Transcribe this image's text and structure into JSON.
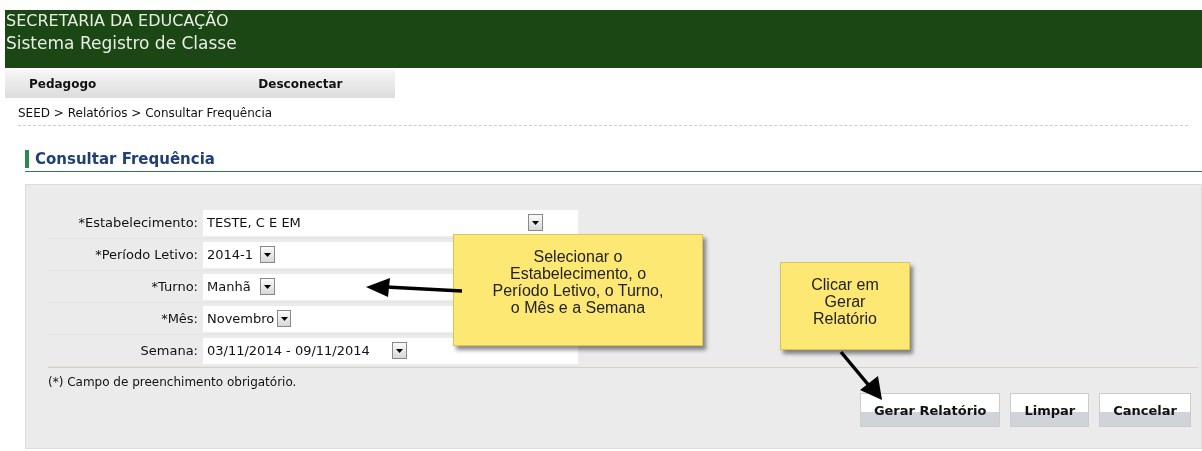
{
  "header": {
    "org": "SECRETARIA DA EDUCAÇÃO",
    "system": "Sistema Registro de Classe"
  },
  "nav": [
    {
      "label": "Pedagogo"
    },
    {
      "label": "Desconectar"
    }
  ],
  "breadcrumb": "SEED > Relatórios > Consultar Frequência",
  "title": "Consultar Frequência",
  "form": {
    "fields": [
      {
        "label": "*Estabelecimento:",
        "value": "TESTE, C E EM"
      },
      {
        "label": "*Período Letivo:",
        "value": "2014-1"
      },
      {
        "label": "*Turno:",
        "value": "Manhã"
      },
      {
        "label": "*Mês:",
        "value": "Novembro"
      },
      {
        "label": "Semana:",
        "value": "03/11/2014 - 09/11/2014"
      }
    ],
    "note": "(*) Campo de preenchimento obrigatório.",
    "buttons": [
      {
        "label": "Gerar Relatório"
      },
      {
        "label": "Limpar"
      },
      {
        "label": "Cancelar"
      }
    ]
  },
  "callouts": [
    {
      "lines": [
        "Selecionar o",
        "Estabelecimento, o",
        "Período Letivo, o Turno,",
        "o Mês e a Semana"
      ]
    },
    {
      "lines": [
        "Clicar em",
        "Gerar",
        "Relatório"
      ]
    }
  ]
}
